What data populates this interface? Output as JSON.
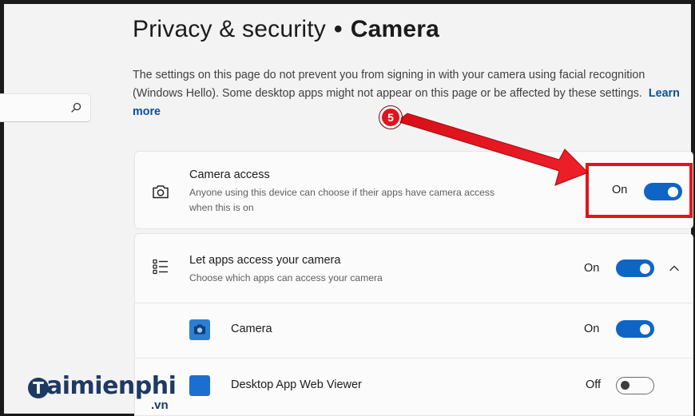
{
  "search": {
    "placeholder": ""
  },
  "page": {
    "title_section": "Privacy & security",
    "title_separator": "•",
    "title_page": "Camera",
    "description": "The settings on this page do not prevent you from signing in with your camera using facial recognition (Windows Hello). Some desktop apps might not appear on this page or be affected by these settings.",
    "learn_more": "Learn more"
  },
  "camera_access": {
    "title": "Camera access",
    "subtitle": "Anyone using this device can choose if their apps have camera access when this is on",
    "state": "On",
    "enabled": true,
    "icon": "camera-icon"
  },
  "app_access": {
    "title": "Let apps access your camera",
    "subtitle": "Choose which apps can access your camera",
    "state": "On",
    "enabled": true,
    "icon": "app-list-icon",
    "expanded": true,
    "apps": [
      {
        "name": "Camera",
        "state": "On",
        "enabled": true,
        "icon": "camera-app-icon"
      },
      {
        "name": "Desktop App Web Viewer",
        "state": "Off",
        "enabled": false,
        "icon": "web-viewer-app-icon"
      }
    ]
  },
  "annotation": {
    "step_number": "5"
  },
  "watermark": {
    "brand": "aimienphi",
    "domain": ".vn",
    "initial": "T"
  },
  "colors": {
    "accent": "#0f65c4",
    "highlight": "#e2141c",
    "link": "#0a4ea0",
    "watermark": "#1d3a63"
  }
}
